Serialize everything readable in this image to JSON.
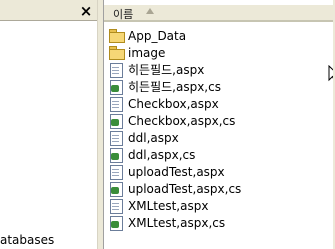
{
  "left_panel": {
    "close_glyph": "×",
    "partial_text": "atabases"
  },
  "file_list": {
    "column_header": "이름",
    "sort": "ascending",
    "items": [
      {
        "name": "App_Data",
        "icon": "folder-icon"
      },
      {
        "name": "image",
        "icon": "folder-icon"
      },
      {
        "name": "히든필드,aspx",
        "icon": "aspx-file-icon"
      },
      {
        "name": "히든필드,aspx,cs",
        "icon": "cs-file-icon"
      },
      {
        "name": "Checkbox,aspx",
        "icon": "aspx-file-icon"
      },
      {
        "name": "Checkbox,aspx,cs",
        "icon": "cs-file-icon"
      },
      {
        "name": "ddl,aspx",
        "icon": "aspx-file-icon"
      },
      {
        "name": "ddl,aspx,cs",
        "icon": "cs-file-icon"
      },
      {
        "name": "uploadTest,aspx",
        "icon": "aspx-file-icon"
      },
      {
        "name": "uploadTest,aspx,cs",
        "icon": "cs-file-icon"
      },
      {
        "name": "XMLtest,aspx",
        "icon": "aspx-file-icon"
      },
      {
        "name": "XMLtest,aspx,cs",
        "icon": "cs-file-icon"
      }
    ]
  }
}
